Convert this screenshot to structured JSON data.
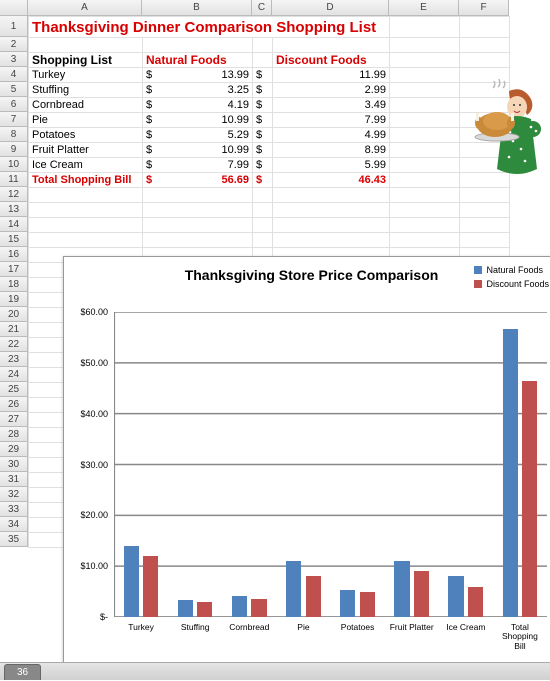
{
  "columns": [
    "A",
    "B",
    "C",
    "D",
    "E",
    "F"
  ],
  "row_count": 35,
  "title": "Thanksgiving Dinner Comparison Shopping List",
  "table": {
    "header": {
      "label": "Shopping List",
      "store1": "Natural Foods",
      "store2": "Discount Foods"
    },
    "currency": "$",
    "items": [
      {
        "name": "Turkey",
        "p1": "13.99",
        "p2": "11.99"
      },
      {
        "name": "Stuffing",
        "p1": "3.25",
        "p2": "2.99"
      },
      {
        "name": "Cornbread",
        "p1": "4.19",
        "p2": "3.49"
      },
      {
        "name": "Pie",
        "p1": "10.99",
        "p2": "7.99"
      },
      {
        "name": "Potatoes",
        "p1": "5.29",
        "p2": "4.99"
      },
      {
        "name": "Fruit Platter",
        "p1": "10.99",
        "p2": "8.99"
      },
      {
        "name": "Ice Cream",
        "p1": "7.99",
        "p2": "5.99"
      }
    ],
    "total": {
      "label": "Total Shopping Bill",
      "p1": "56.69",
      "p2": "46.43"
    }
  },
  "clipart": "woman-holding-turkey",
  "chart_data": {
    "type": "bar",
    "title": "Thanksgiving Store Price Comparison",
    "categories": [
      "Turkey",
      "Stuffing",
      "Cornbread",
      "Pie",
      "Potatoes",
      "Fruit Platter",
      "Ice Cream",
      "Total Shopping Bill"
    ],
    "categories_wrapped": [
      "Turkey",
      "Stuffing",
      "Cornbread",
      "Pie",
      "Potatoes",
      "Fruit Platter",
      "Ice Cream",
      "Total\nShopping\nBill"
    ],
    "series": [
      {
        "name": "Natural Foods",
        "color": "#4f81bd",
        "values": [
          13.99,
          3.25,
          4.19,
          10.99,
          5.29,
          10.99,
          7.99,
          56.69
        ]
      },
      {
        "name": "Discount Foods",
        "color": "#c0504d",
        "values": [
          11.99,
          2.99,
          3.49,
          7.99,
          4.99,
          8.99,
          5.99,
          46.43
        ]
      }
    ],
    "ylim": [
      0,
      60
    ],
    "yticks": [
      0,
      10,
      20,
      30,
      40,
      50,
      60
    ],
    "ytick_labels": [
      "$-",
      "$10.00",
      "$20.00",
      "$30.00",
      "$40.00",
      "$50.00",
      "$60.00"
    ],
    "xlabel": "",
    "ylabel": ""
  },
  "tab_active": "36"
}
